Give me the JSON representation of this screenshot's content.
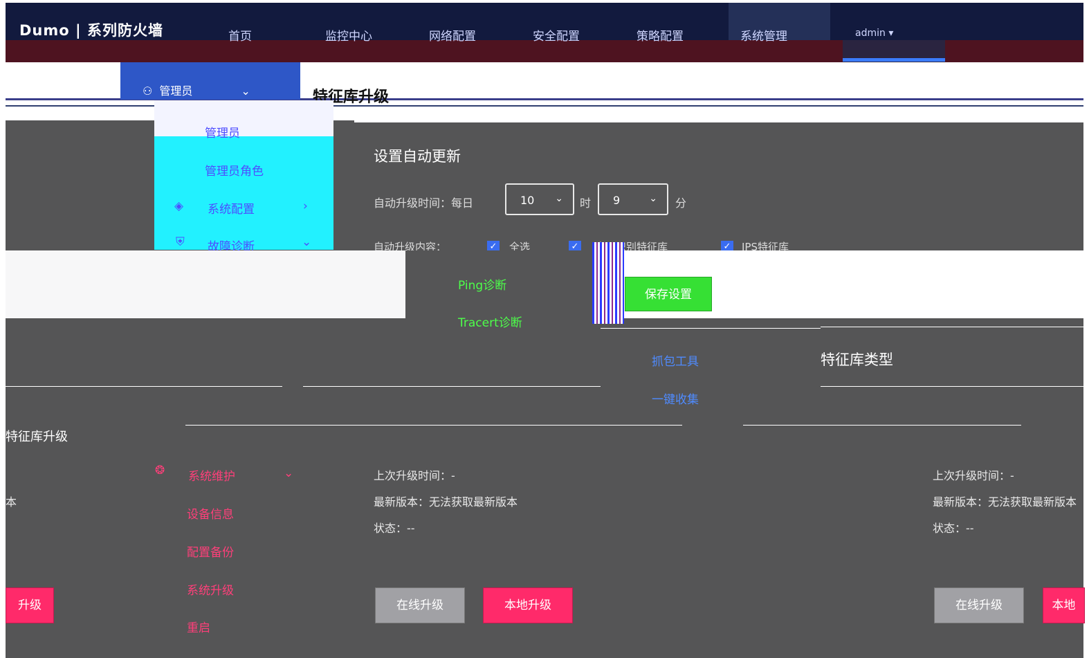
{
  "header": {
    "logo": "Dumo | 系列防火墙",
    "nav": [
      "首页",
      "监控中心",
      "网络配置",
      "安全配置",
      "策略配置",
      "系统管理"
    ],
    "user": "admin ▾"
  },
  "toolbar": {
    "admin_label": "管理员",
    "page_title": "特征库升级"
  },
  "menu": {
    "admin": "管理员",
    "admin_role": "管理员角色",
    "system_config": "系统配置",
    "fault_diag": "故障诊断",
    "ping": "Ping诊断",
    "tracert": "Tracert诊断",
    "capture": "抓包工具",
    "one_click": "一键收集",
    "system_maint": "系统维护",
    "device_info": "设备信息",
    "config_backup": "配置备份",
    "system_upgrade": "系统升级",
    "reboot": "重启"
  },
  "settings": {
    "title": "设置自动更新",
    "time_label": "自动升级时间：每日",
    "hour": "10",
    "minute": "9",
    "hour_unit": "时",
    "minute_unit": "分",
    "content_label": "自动升级内容：",
    "select_all": "全选",
    "app_lib": "应用识别特征库",
    "ips_lib": "IPS特征库",
    "save": "保存设置"
  },
  "cards": {
    "left_title": "特征库升级",
    "middle_title": "特征库类型",
    "last_upgrade": "上次升级时间：-",
    "latest": "最新版本：无法获取最新版本",
    "status": "状态：--",
    "left_latest_partial": "本",
    "online": "在线升级",
    "local": "本地升级",
    "left_btn_partial": "升级",
    "right_btn_partial": "本地"
  }
}
